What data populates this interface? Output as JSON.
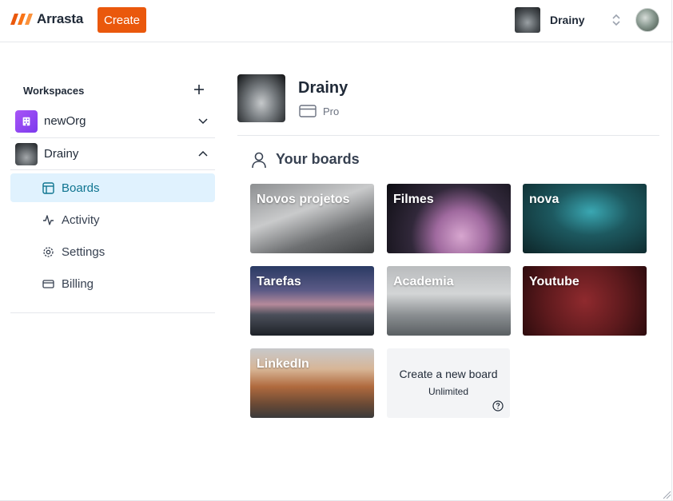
{
  "topbar": {
    "logo_text": "Arrasta",
    "create_label": "Create",
    "org_name": "Drainy"
  },
  "sidebar": {
    "workspaces_title": "Workspaces",
    "orgs": [
      {
        "name": "newOrg",
        "expanded": false
      },
      {
        "name": "Drainy",
        "expanded": true
      }
    ],
    "nav": [
      {
        "label": "Boards",
        "icon": "layout-icon",
        "active": true
      },
      {
        "label": "Activity",
        "icon": "activity-icon",
        "active": false
      },
      {
        "label": "Settings",
        "icon": "settings-icon",
        "active": false
      },
      {
        "label": "Billing",
        "icon": "credit-card-icon",
        "active": false
      }
    ]
  },
  "main": {
    "workspace_name": "Drainy",
    "plan": "Pro",
    "boards_title": "Your boards",
    "boards": [
      {
        "title": "Novos projetos"
      },
      {
        "title": "Filmes"
      },
      {
        "title": "nova"
      },
      {
        "title": "Tarefas"
      },
      {
        "title": "Academia"
      },
      {
        "title": "Youtube"
      },
      {
        "title": "LinkedIn"
      }
    ],
    "new_board": {
      "title": "Create a new board",
      "subtitle": "Unlimited"
    }
  },
  "colors": {
    "accent": "#ea580c",
    "active_bg": "#e0f2fe",
    "active_text": "#0e7490",
    "org_icon": "#8b5cf6"
  }
}
